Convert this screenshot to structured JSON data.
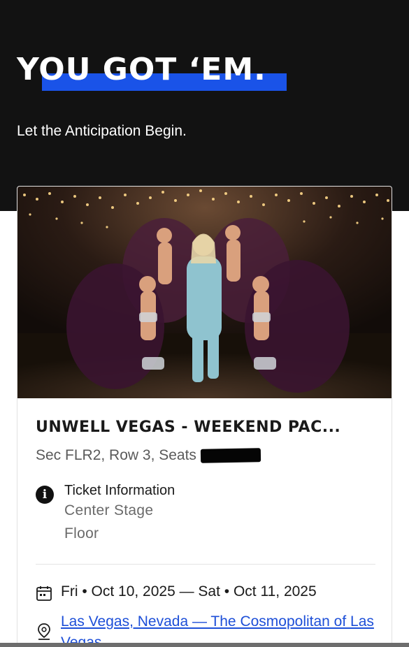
{
  "header": {
    "headline": "YOU GOT ‘EM.",
    "subhead": "Let the Anticipation Begin."
  },
  "event": {
    "title": "UNWELL VEGAS - WEEKEND PAC...",
    "seat_info": "Sec FLR2, Row 3, Seats",
    "ticket_info_label": "Ticket Information",
    "ticket_lines": [
      "Center Stage",
      "Floor"
    ],
    "date_range": "Fri • Oct 10, 2025 — Sat • Oct 11, 2025",
    "venue": "Las Vegas, Nevada — The Cosmopolitan of Las Vegas"
  },
  "colors": {
    "header_bg": "#121212",
    "highlight": "#1a53e8",
    "link": "#1d4fd8"
  },
  "icons": {
    "info": "info-icon",
    "calendar": "calendar-icon",
    "location": "location-pin-icon"
  }
}
